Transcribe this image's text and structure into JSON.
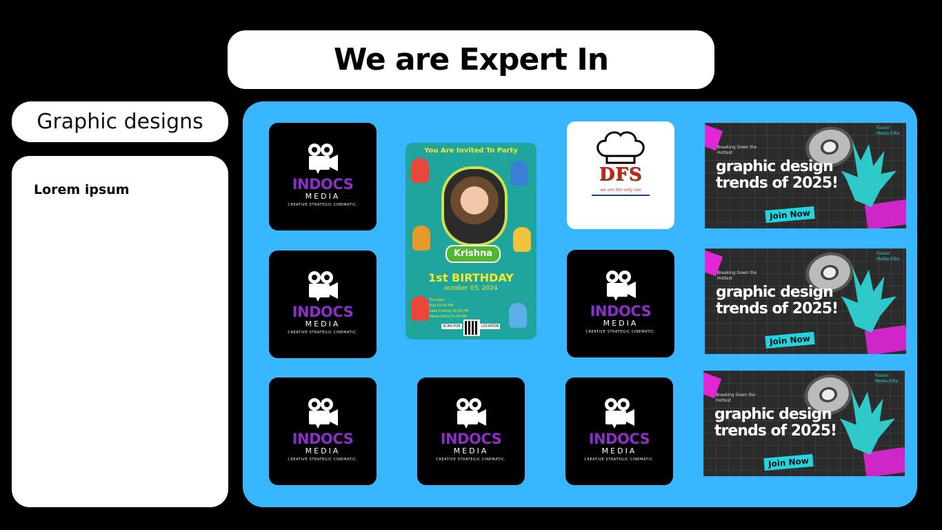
{
  "header": {
    "title": "We are Expert In"
  },
  "category": {
    "label": "Graphic designs"
  },
  "side_card": {
    "heading": "Lorem ipsum"
  },
  "logo_tile": {
    "name": "INDOCS",
    "sub": "MEDIA",
    "tagline": "CREATIVE STRATEGIC CINEMATIC."
  },
  "invite_card": {
    "headline": "You Are Invited To Party",
    "name": "Krishna",
    "occasion": "1st BIRTHDAY",
    "date": "october 03, 2024",
    "schedule": [
      "Thursday",
      "Puja 01:00 PM",
      "Cake Cutting 01:00 PM",
      "Sweet Party 01:00 PM"
    ],
    "scan_label": "SCAN FOR",
    "location_label": "LOCATION"
  },
  "dfs_card": {
    "letters": "DFS",
    "tagline": "we are the only one"
  },
  "banner": {
    "brand_line1": "Fusion",
    "brand_line2": "Media Elite.",
    "kicker": "Breaking Down the Hottest",
    "headline": "graphic design trends of 2025!",
    "cta": "Join Now"
  },
  "colors": {
    "panel": "#38b6ff",
    "logo_purple": "#8b2fc9",
    "banner_cta": "#23d3e0",
    "banner_pink": "#e126d8"
  }
}
